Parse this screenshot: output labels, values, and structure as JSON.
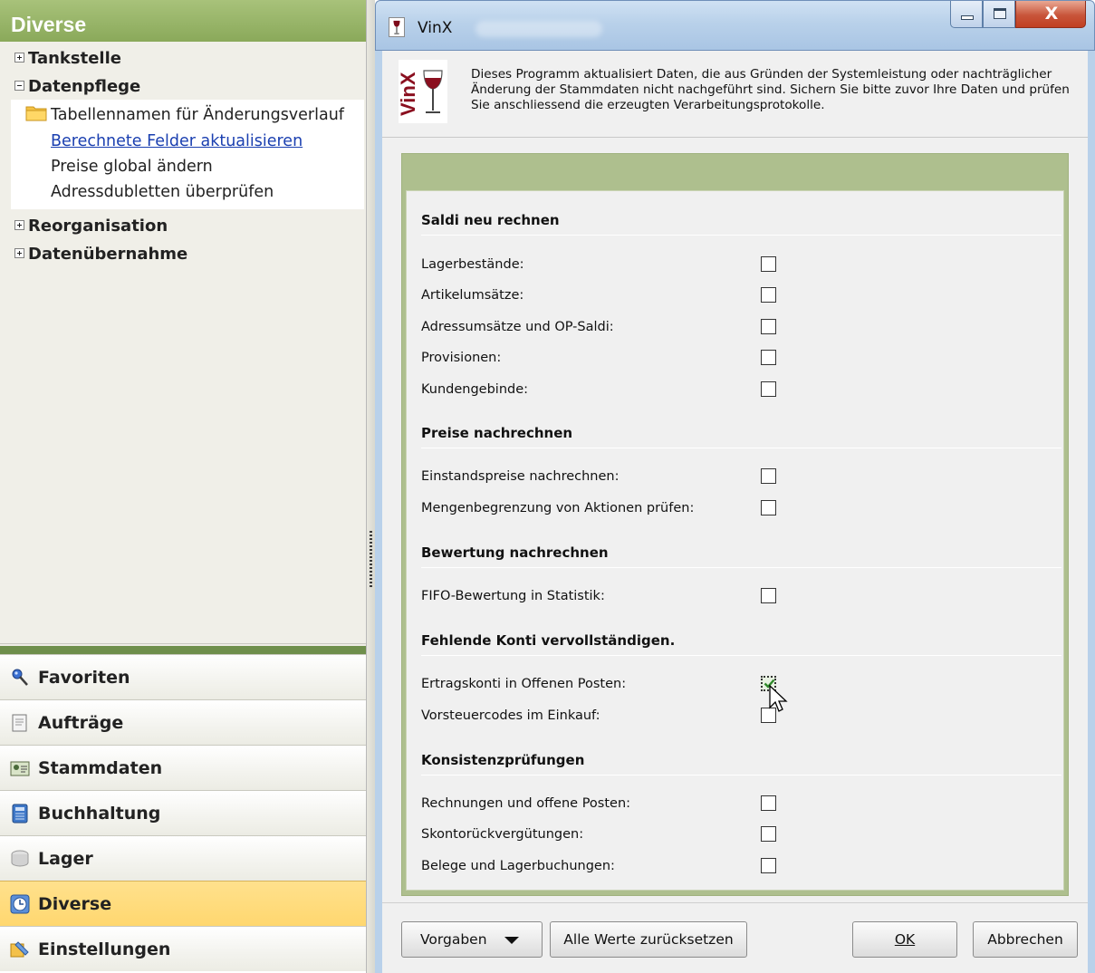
{
  "left_pane": {
    "header": "Diverse",
    "tree": {
      "groups": [
        {
          "label": "Tankstelle",
          "expanded": false
        },
        {
          "label": "Datenpflege",
          "expanded": true
        },
        {
          "label": "Reorganisation",
          "expanded": false
        },
        {
          "label": "Datenübernahme",
          "expanded": false
        }
      ],
      "datenpflege_items": [
        {
          "label": "Tabellennamen für Änderungsverlauf",
          "icon": "folder-icon"
        },
        {
          "label": "Berechnete Felder aktualisieren",
          "selected_link": true
        },
        {
          "label": "Preise global ändern"
        },
        {
          "label": "Adressdubletten überprüfen"
        }
      ]
    },
    "nav_buttons": [
      {
        "label": "Favoriten",
        "icon": "pin-icon"
      },
      {
        "label": "Aufträge",
        "icon": "document-icon"
      },
      {
        "label": "Stammdaten",
        "icon": "address-card-icon"
      },
      {
        "label": "Buchhaltung",
        "icon": "ledger-icon"
      },
      {
        "label": "Lager",
        "icon": "box-icon"
      },
      {
        "label": "Diverse",
        "icon": "clock-icon",
        "active": true
      },
      {
        "label": "Einstellungen",
        "icon": "settings-icon"
      }
    ]
  },
  "dialog": {
    "title": "VinX",
    "logo_text": "VinX",
    "info_text": "Dieses Programm aktualisiert Daten, die aus Gründen der Systemleistung oder nachträglicher Änderung der Stammdaten nicht nachgeführt sind. Sichern Sie bitte zuvor Ihre Daten und prüfen Sie anschliessend die erzeugten Verarbeitungsprotokolle.",
    "close_label": "X",
    "sections": [
      {
        "title": "Saldi neu rechnen",
        "rows": [
          {
            "label": "Lagerbestände:",
            "checked": false
          },
          {
            "label": "Artikelumsätze:",
            "checked": false
          },
          {
            "label": "Adressumsätze und OP-Saldi:",
            "checked": false
          },
          {
            "label": "Provisionen:",
            "checked": false
          },
          {
            "label": "Kundengebinde:",
            "checked": false
          }
        ]
      },
      {
        "title": "Preise nachrechnen",
        "rows": [
          {
            "label": "Einstandspreise nachrechnen:",
            "checked": false
          },
          {
            "label": "Mengenbegrenzung von Aktionen prüfen:",
            "checked": false
          }
        ]
      },
      {
        "title": "Bewertung nachrechnen",
        "rows": [
          {
            "label": "FIFO-Bewertung in Statistik:",
            "checked": false
          }
        ]
      },
      {
        "title": "Fehlende Konti vervollständigen.",
        "rows": [
          {
            "label": "Ertragskonti in Offenen Posten:",
            "checked": true
          },
          {
            "label": "Vorsteuercodes im Einkauf:",
            "checked": false
          }
        ]
      },
      {
        "title": "Konsistenzprüfungen",
        "rows": [
          {
            "label": "Rechnungen und offene Posten:",
            "checked": false
          },
          {
            "label": "Skontorückvergütungen:",
            "checked": false
          },
          {
            "label": "Belege und Lagerbuchungen:",
            "checked": false
          }
        ]
      }
    ],
    "buttons": {
      "vorgaben": "Vorgaben",
      "reset": "Alle Werte zurücksetzen",
      "ok": "OK",
      "cancel": "Abbrechen"
    },
    "colors": {
      "accent_green": "#8aa95a",
      "active_nav": "#ffd76f",
      "panel_green": "#aebf8e",
      "link_blue": "#1a3fb0"
    }
  }
}
